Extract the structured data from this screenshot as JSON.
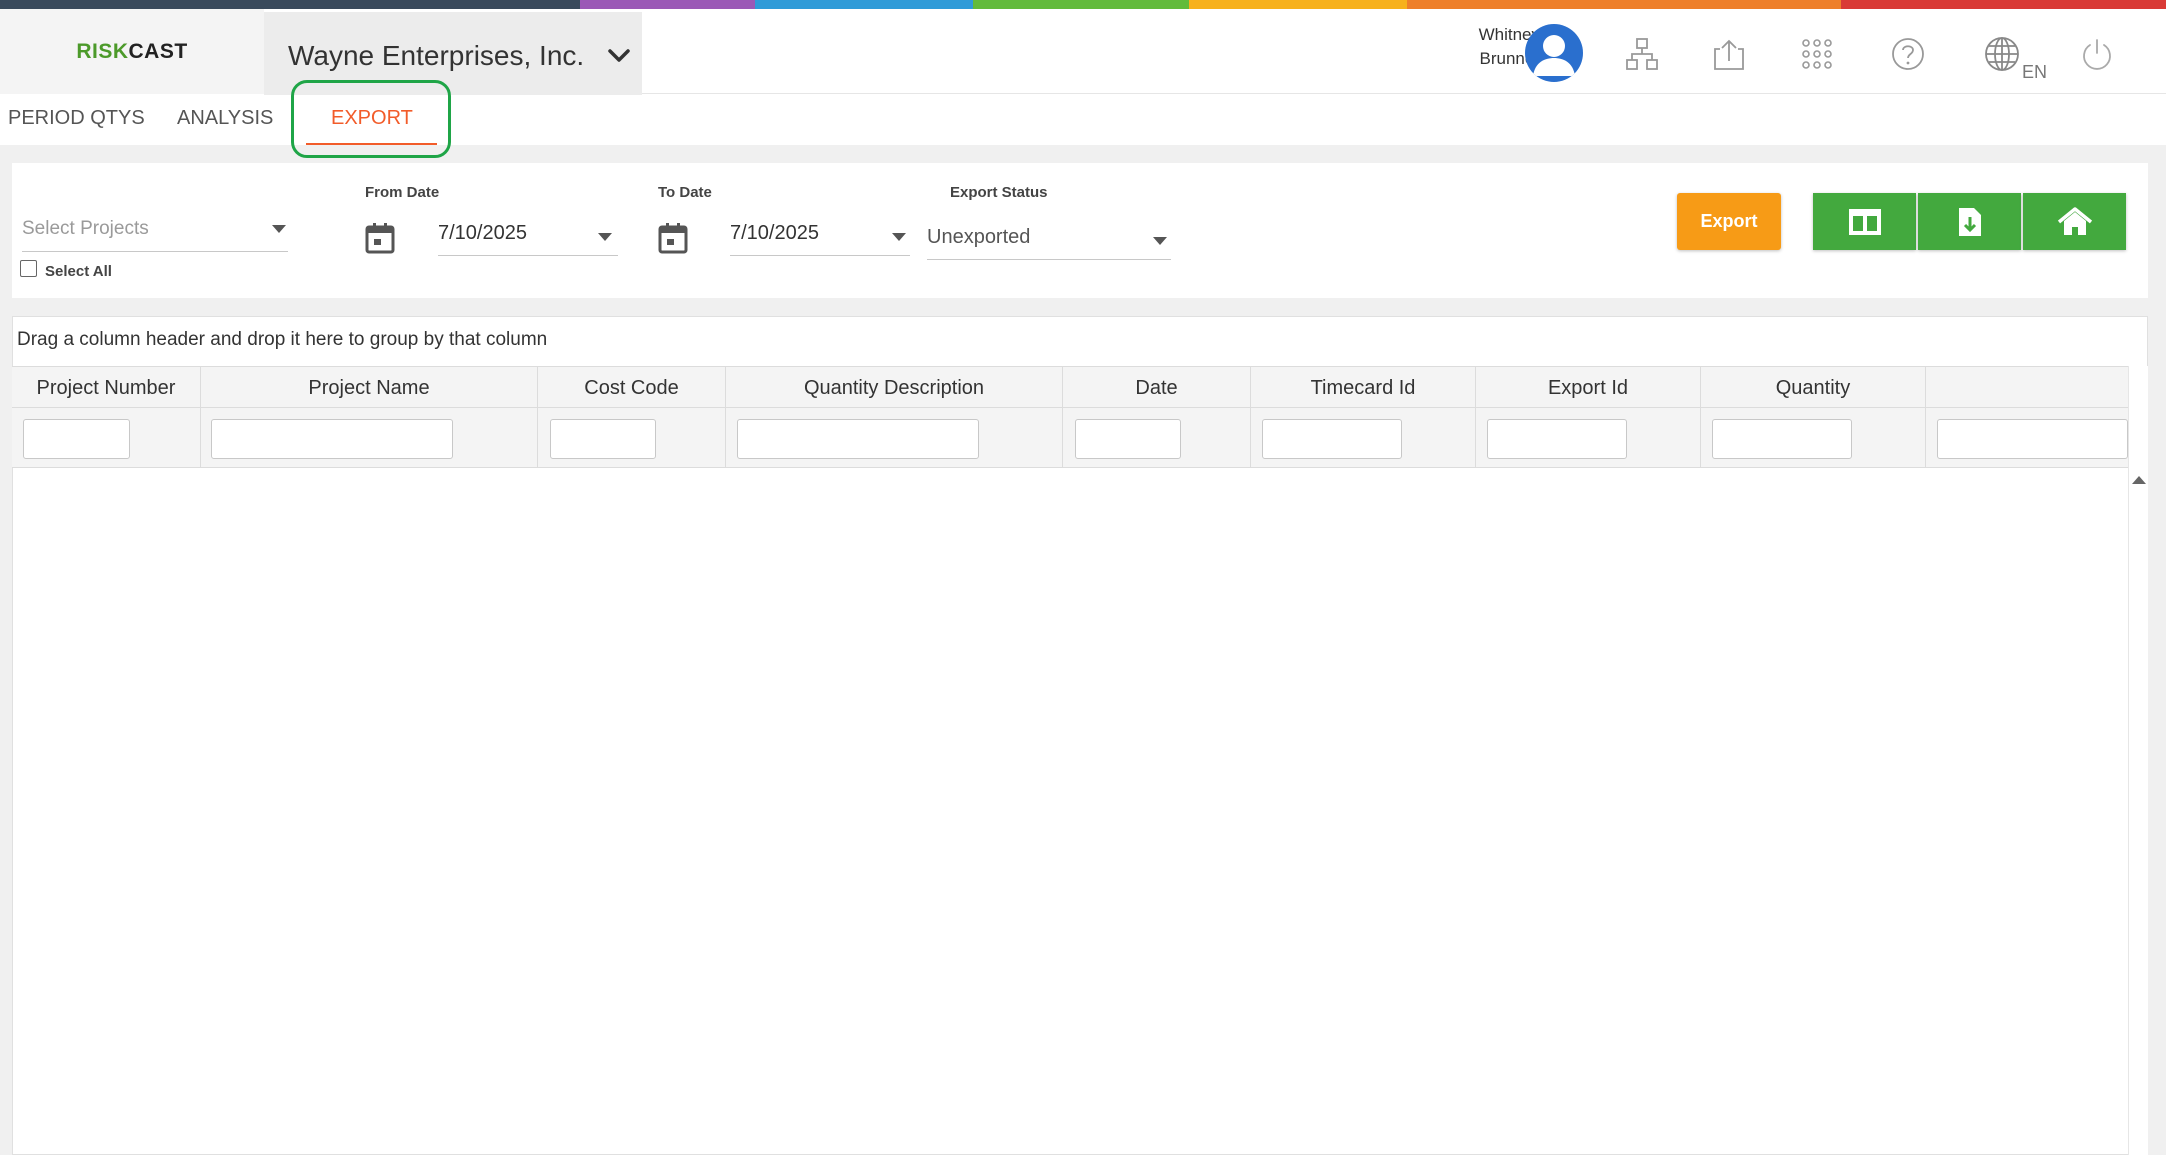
{
  "brand": {
    "logo_part1": "RISK",
    "logo_part2": "CAST",
    "green": "#4c9a2a",
    "orange": "#f25c2a"
  },
  "stripe_colors": [
    "#3a4a5c",
    "#3a4a5c",
    "#9b59b6",
    "#2f9bd8",
    "#62bb3b",
    "#f7b11c",
    "#ee7f2a",
    "#d93a36"
  ],
  "header": {
    "company": "Wayne Enterprises, Inc.",
    "user_first": "Whitney",
    "user_last": "Brunner",
    "lang": "EN",
    "icons": [
      "user-avatar-icon",
      "hierarchy-icon",
      "upload-icon",
      "apps-grid-icon",
      "help-icon",
      "globe-icon",
      "power-icon"
    ]
  },
  "tabs": [
    {
      "label": "PERIOD QTYS",
      "active": false
    },
    {
      "label": "ANALYSIS",
      "active": false
    },
    {
      "label": "EXPORT",
      "active": true
    }
  ],
  "filters": {
    "projects_placeholder": "Select Projects",
    "select_all_label": "Select All",
    "from_date_label": "From Date",
    "from_date": "7/10/2025",
    "to_date_label": "To Date",
    "to_date": "7/10/2025",
    "status_label": "Export Status",
    "status": "Unexported"
  },
  "actions": {
    "export_label": "Export",
    "export_color": "#f79b16",
    "icon_buttons": [
      "columns-icon",
      "download-file-icon",
      "home-icon"
    ],
    "icon_button_color": "#43a93e"
  },
  "grid": {
    "group_hint": "Drag a column header and drop it here to group by that column",
    "columns": [
      "Project Number",
      "Project Name",
      "Cost Code",
      "Quantity Description",
      "Date",
      "Timecard Id",
      "Export Id",
      "Quantity",
      ""
    ],
    "rows": []
  }
}
